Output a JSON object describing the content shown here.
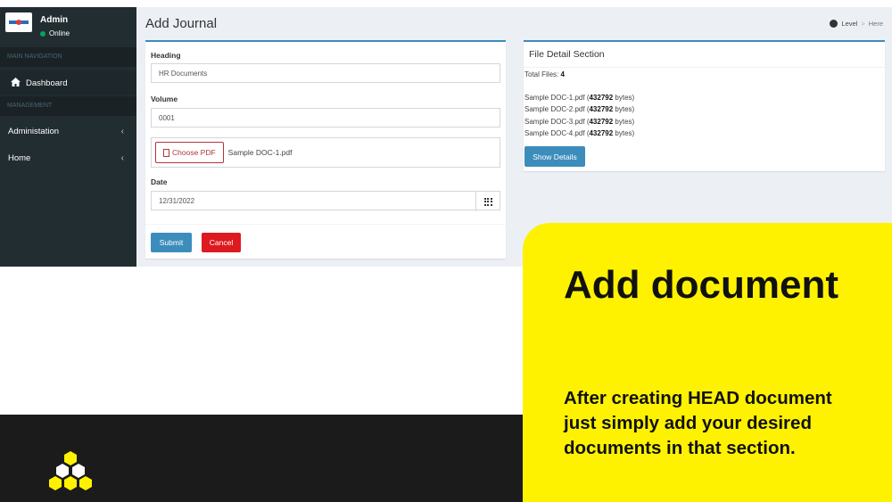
{
  "user": {
    "name": "Admin",
    "status": "Online"
  },
  "sidebar": {
    "headers": [
      "MAIN NAVIGATION",
      "MANAGEMENT"
    ],
    "items": [
      {
        "label": "Dashboard",
        "icon": "home-icon"
      },
      {
        "label": "Administation",
        "icon": "chevron-left-icon"
      },
      {
        "label": "Home",
        "icon": "chevron-left-icon"
      }
    ]
  },
  "page": {
    "title": "Add Journal",
    "breadcrumb": [
      "Level",
      "Here"
    ]
  },
  "form": {
    "heading_label": "Heading",
    "heading_value": "HR Documents",
    "volume_label": "Volume",
    "volume_value": "0001",
    "choose_label": "Choose PDF",
    "file_name": "Sample DOC-1.pdf",
    "date_label": "Date",
    "date_value": "12/31/2022",
    "submit_label": "Submit",
    "cancel_label": "Cancel"
  },
  "file_detail": {
    "title": "File Detail Section",
    "total_label": "Total Files:",
    "total_count": "4",
    "files": [
      {
        "name": "Sample DOC-1.pdf",
        "size": "432792"
      },
      {
        "name": "Sample DOC-2.pdf",
        "size": "432792"
      },
      {
        "name": "Sample DOC-3.pdf",
        "size": "432792"
      },
      {
        "name": "Sample DOC-4.pdf",
        "size": "432792"
      }
    ],
    "size_unit": "bytes",
    "show_details_label": "Show Details"
  },
  "promo": {
    "title": "Add document",
    "description": "After creating HEAD document just simply add your desired documents in that section."
  },
  "colors": {
    "primary": "#3c8dbc",
    "danger": "#dd1a1f",
    "sidebar": "#222d32",
    "promo_yellow": "#fff200",
    "band_dark": "#1b1b1b"
  }
}
